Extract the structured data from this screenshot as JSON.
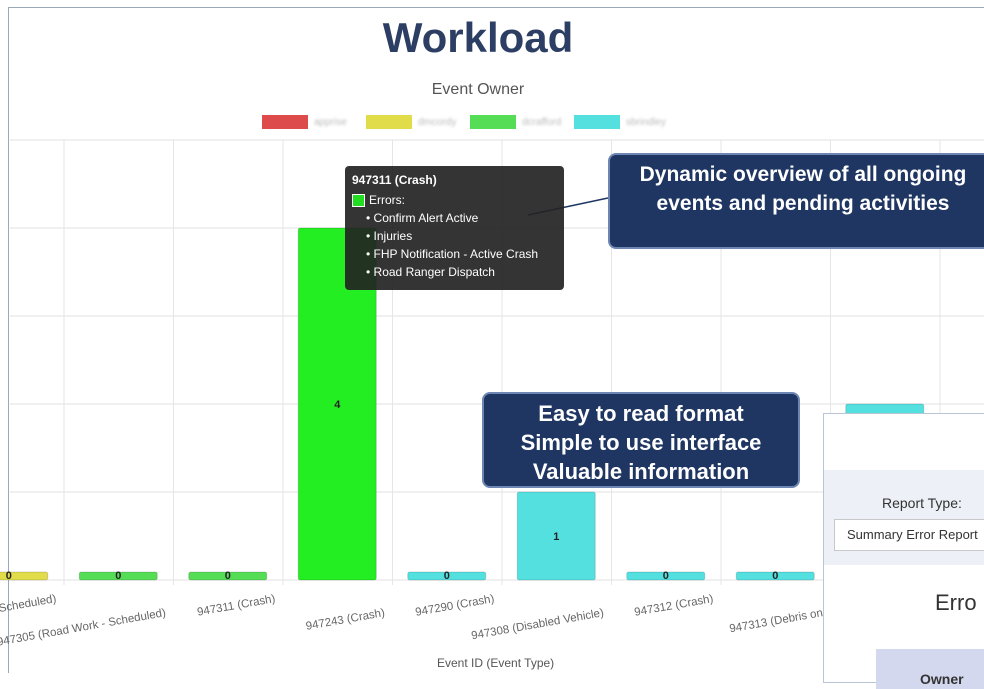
{
  "title": "Workload",
  "subtitle": "Event Owner",
  "legend": [
    {
      "label": "apprise",
      "color": "#dd4b4b"
    },
    {
      "label": "dmcordy",
      "color": "#e0dc4a"
    },
    {
      "label": "dcrafford",
      "color": "#55dd55"
    },
    {
      "label": "sbrindley",
      "color": "#55e0e0"
    }
  ],
  "chart_data": {
    "type": "bar",
    "xlabel": "Event ID (Event Type)",
    "ylabel": "",
    "categories": [
      "Work - Scheduled)",
      "947305 (Road Work - Scheduled)",
      "947311 (Crash)",
      "947243 (Crash)",
      "947290 (Crash)",
      "947308 (Disabled Vehicle)",
      "947312 (Crash)",
      "947313 (Debris on",
      ""
    ],
    "values": [
      0,
      0,
      0,
      4,
      0,
      1,
      0,
      0,
      2
    ],
    "bar_colors": [
      "#e0dc4a",
      "#55dd55",
      "#55dd55",
      "#22ee22",
      "#55e0e0",
      "#55e0e0",
      "#55e0e0",
      "#55e0e0",
      "#55e0e0"
    ],
    "data_labels": [
      "0",
      "0",
      "0",
      "4",
      "0",
      "1",
      "0",
      "0",
      ""
    ],
    "ylim": [
      0,
      4
    ],
    "grid": true
  },
  "tooltip": {
    "title": "947311 (Crash)",
    "series_label": "Errors:",
    "items": [
      "Confirm Alert Active",
      "Injuries",
      "FHP Notification - Active Crash",
      "Road Ranger Dispatch"
    ]
  },
  "callouts": {
    "overview": "Dynamic overview of all ongoing events and pending activities",
    "format_line1": "Easy to read format",
    "format_line2": "Simple to use interface",
    "format_line3": "Valuable information"
  },
  "report_panel": {
    "report_type_label": "Report Type:",
    "selected_report": "Summary Error Report",
    "heading": "Erro",
    "owner_header": "Owner"
  }
}
